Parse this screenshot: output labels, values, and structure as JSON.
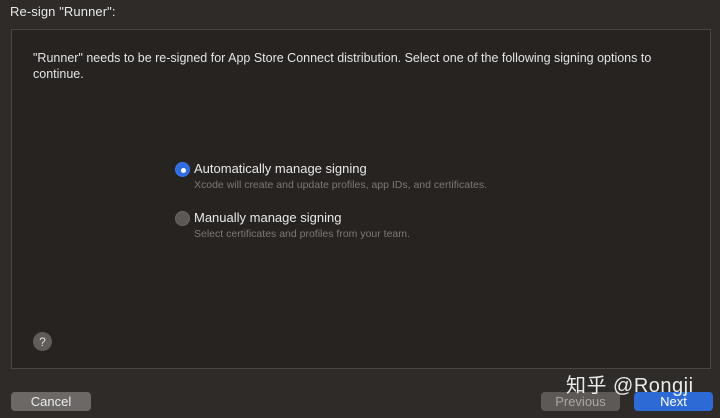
{
  "window": {
    "title": "Re-sign \"Runner\":"
  },
  "panel": {
    "description": "\"Runner\" needs to be re-signed for App Store Connect distribution. Select one of the following signing options to continue.",
    "options": [
      {
        "label": "Automatically manage signing",
        "subtitle": "Xcode will create and update profiles, app IDs, and certificates.",
        "selected": true
      },
      {
        "label": "Manually manage signing",
        "subtitle": "Select certificates and profiles from your team.",
        "selected": false
      }
    ],
    "help_label": "?"
  },
  "footer": {
    "cancel_label": "Cancel",
    "previous_label": "Previous",
    "next_label": "Next",
    "previous_enabled": false
  },
  "watermark": "知乎 @Rongji",
  "colors": {
    "accent": "#2e6ad6",
    "background": "#2e2b29",
    "panel": "#272321"
  }
}
